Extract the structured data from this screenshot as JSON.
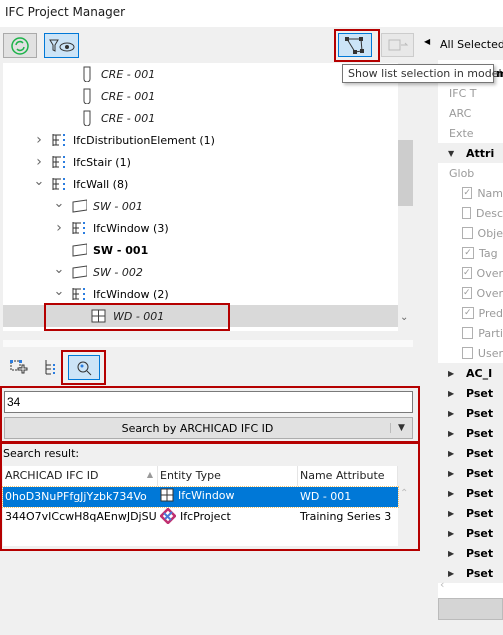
{
  "window": {
    "title": "IFC Project Manager"
  },
  "toolbar": {
    "refresh_icon": "refresh-icon",
    "filter_icon": "filter-eye-icon",
    "show_selection_icon": "show-selection-icon",
    "tooltip": "Show list selection in model"
  },
  "tree": {
    "items": [
      {
        "label": "CRE - 001",
        "style": "italic",
        "icon": "column-icon"
      },
      {
        "label": "CRE - 001",
        "style": "italic",
        "icon": "column-icon"
      },
      {
        "label": "CRE - 001",
        "style": "italic",
        "icon": "column-icon"
      },
      {
        "label": "IfcDistributionElement (1)",
        "style": "normal",
        "icon": "type-group-icon",
        "chevron": "right"
      },
      {
        "label": "IfcStair (1)",
        "style": "normal",
        "icon": "type-group-icon",
        "chevron": "right"
      },
      {
        "label": "IfcWall (8)",
        "style": "normal",
        "icon": "type-group-icon",
        "chevron": "down"
      },
      {
        "label": "SW - 001",
        "style": "italic",
        "icon": "wall-icon",
        "chevron": "down"
      },
      {
        "label": "IfcWindow (3)",
        "style": "normal",
        "icon": "type-group-icon",
        "chevron": "right"
      },
      {
        "label": "SW - 001",
        "style": "bold",
        "icon": "wall-icon"
      },
      {
        "label": "SW - 002",
        "style": "italic",
        "icon": "wall-icon",
        "chevron": "down"
      },
      {
        "label": "IfcWindow (2)",
        "style": "normal",
        "icon": "type-group-icon",
        "chevron": "down"
      },
      {
        "label": "WD - 001",
        "style": "italic",
        "icon": "window-icon",
        "selected": true
      }
    ]
  },
  "search": {
    "value": "34",
    "button_label": "Search by ARCHICAD IFC ID",
    "result_label": "Search result:"
  },
  "results": {
    "columns": [
      "ARCHICAD IFC ID",
      "Entity Type",
      "Name Attribute"
    ],
    "rows": [
      {
        "id": "0hoD3NuPFfgJjYzbk734Vo",
        "type": "IfcWindow",
        "name": "WD - 001",
        "selected": true
      },
      {
        "id": "344O7vICcwH8qAEnwJDjSU",
        "type": "IfcProject",
        "name": "Training Series 3"
      }
    ]
  },
  "right_panel": {
    "header": "All Selected:",
    "rows": [
      {
        "label": "m",
        "kind": "partial"
      },
      {
        "label": "IFC T",
        "kind": "grey"
      },
      {
        "label": "ARC",
        "kind": "grey"
      },
      {
        "label": "Exte",
        "kind": "grey"
      },
      {
        "label": "Attri",
        "kind": "group",
        "expanded": true
      },
      {
        "label": "Glob",
        "kind": "grey"
      },
      {
        "label": "Nam",
        "kind": "check",
        "checked": true
      },
      {
        "label": "Desc",
        "kind": "check",
        "checked": false
      },
      {
        "label": "Obje",
        "kind": "check",
        "checked": false
      },
      {
        "label": "Tag",
        "kind": "check",
        "checked": true
      },
      {
        "label": "Over",
        "kind": "check",
        "checked": true
      },
      {
        "label": "Over",
        "kind": "check",
        "checked": true
      },
      {
        "label": "Pred",
        "kind": "check",
        "checked": true
      },
      {
        "label": "Parti",
        "kind": "check",
        "checked": false
      },
      {
        "label": "User",
        "kind": "check",
        "checked": false
      },
      {
        "label": "AC_I",
        "kind": "group"
      },
      {
        "label": "Pset",
        "kind": "group"
      },
      {
        "label": "Pset",
        "kind": "group"
      },
      {
        "label": "Pset",
        "kind": "group"
      },
      {
        "label": "Pset",
        "kind": "group"
      },
      {
        "label": "Pset",
        "kind": "group"
      },
      {
        "label": "Pset",
        "kind": "group"
      },
      {
        "label": "Pset",
        "kind": "group"
      },
      {
        "label": "Pset",
        "kind": "group"
      },
      {
        "label": "Pset",
        "kind": "group"
      },
      {
        "label": "Pset",
        "kind": "group"
      }
    ]
  },
  "colors": {
    "accent": "#0078d7",
    "highlight": "#b50000",
    "selected_row": "#d9d9d9"
  }
}
